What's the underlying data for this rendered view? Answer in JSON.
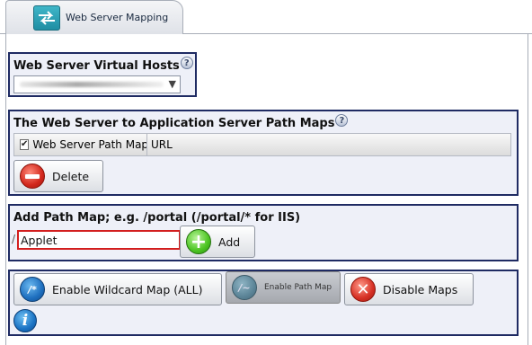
{
  "tab": {
    "label": "Web Server Mapping",
    "icon": "web-server-mapping-icon"
  },
  "virtual_hosts": {
    "title": "Web Server Virtual Hosts",
    "help": "?",
    "selected_value": ""
  },
  "path_maps": {
    "title": "The Web Server to Application Server Path Maps",
    "help": "?",
    "columns": [
      "Web Server Path Map",
      "URL"
    ],
    "header_checked": true,
    "delete_label": "Delete"
  },
  "add_path_map": {
    "title": "Add Path Map; e.g. /portal (/portal/* for IIS)",
    "prefix": "/",
    "input_value": "Applet",
    "add_label": "Add"
  },
  "actions": {
    "enable_wildcard_label": "Enable Wildcard Map (ALL)",
    "enable_path_label": "Enable Path Map",
    "disable_maps_label": "Disable Maps"
  },
  "colors": {
    "group_border": "#1f2b63",
    "group_background": "#eef0f8",
    "input_border_highlight": "#d31e1e"
  }
}
